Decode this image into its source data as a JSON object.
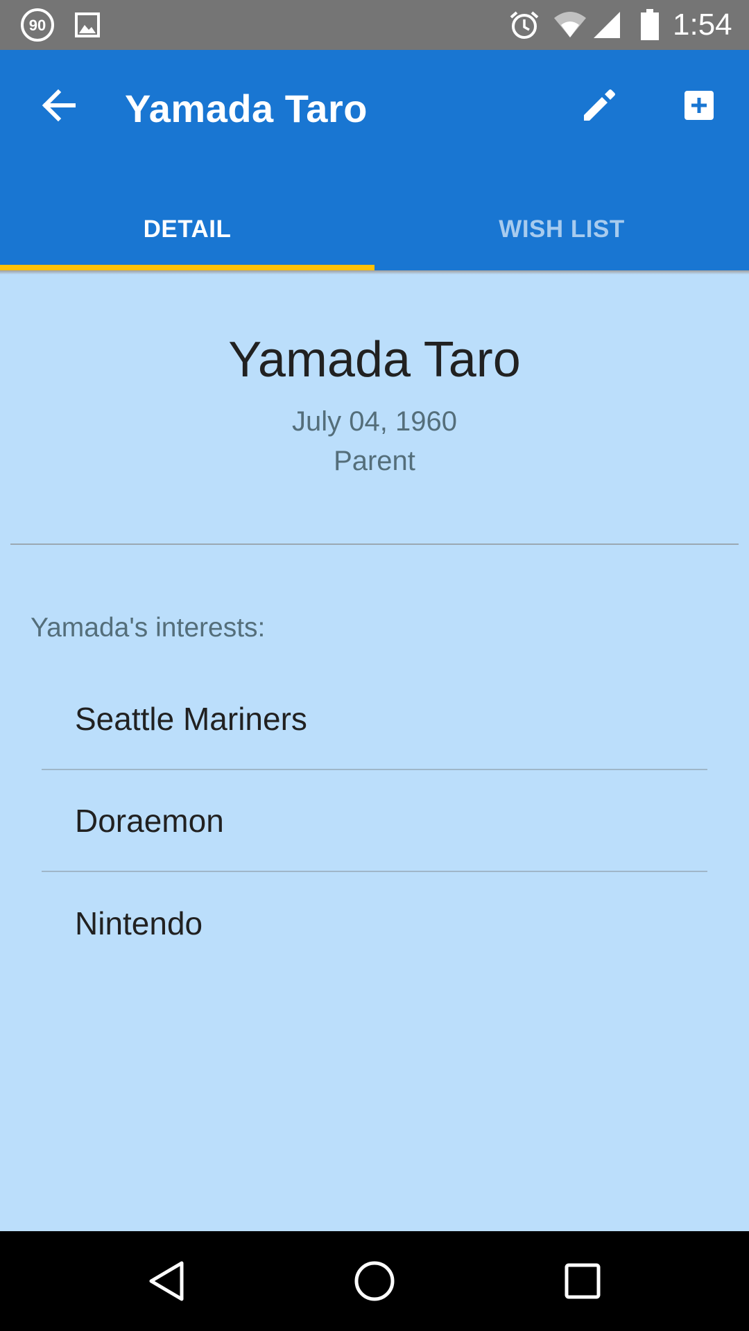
{
  "status_bar": {
    "notification_badge": "90",
    "time": "1:54",
    "icons": [
      "notification-90-icon",
      "image-icon",
      "alarm-icon",
      "wifi-icon",
      "cell-signal-icon",
      "battery-icon"
    ]
  },
  "app_bar": {
    "title": "Yamada Taro",
    "back_icon": "arrow-back-icon",
    "edit_icon": "pencil-icon",
    "add_icon": "add-box-icon",
    "color": "#1976d2",
    "tabs": [
      {
        "label": "DETAIL",
        "active": true
      },
      {
        "label": "WISH LIST",
        "active": false
      }
    ],
    "indicator_color": "#ffc107"
  },
  "profile": {
    "name": "Yamada Taro",
    "birthdate": "July 04, 1960",
    "role": "Parent"
  },
  "interests": {
    "label": "Yamada's interests:",
    "items": [
      "Seattle Mariners",
      "Doraemon",
      "Nintendo"
    ]
  },
  "background_color": "#bbdefb",
  "nav_bar": {
    "icons": [
      "nav-back-icon",
      "nav-home-icon",
      "nav-recents-icon"
    ]
  }
}
